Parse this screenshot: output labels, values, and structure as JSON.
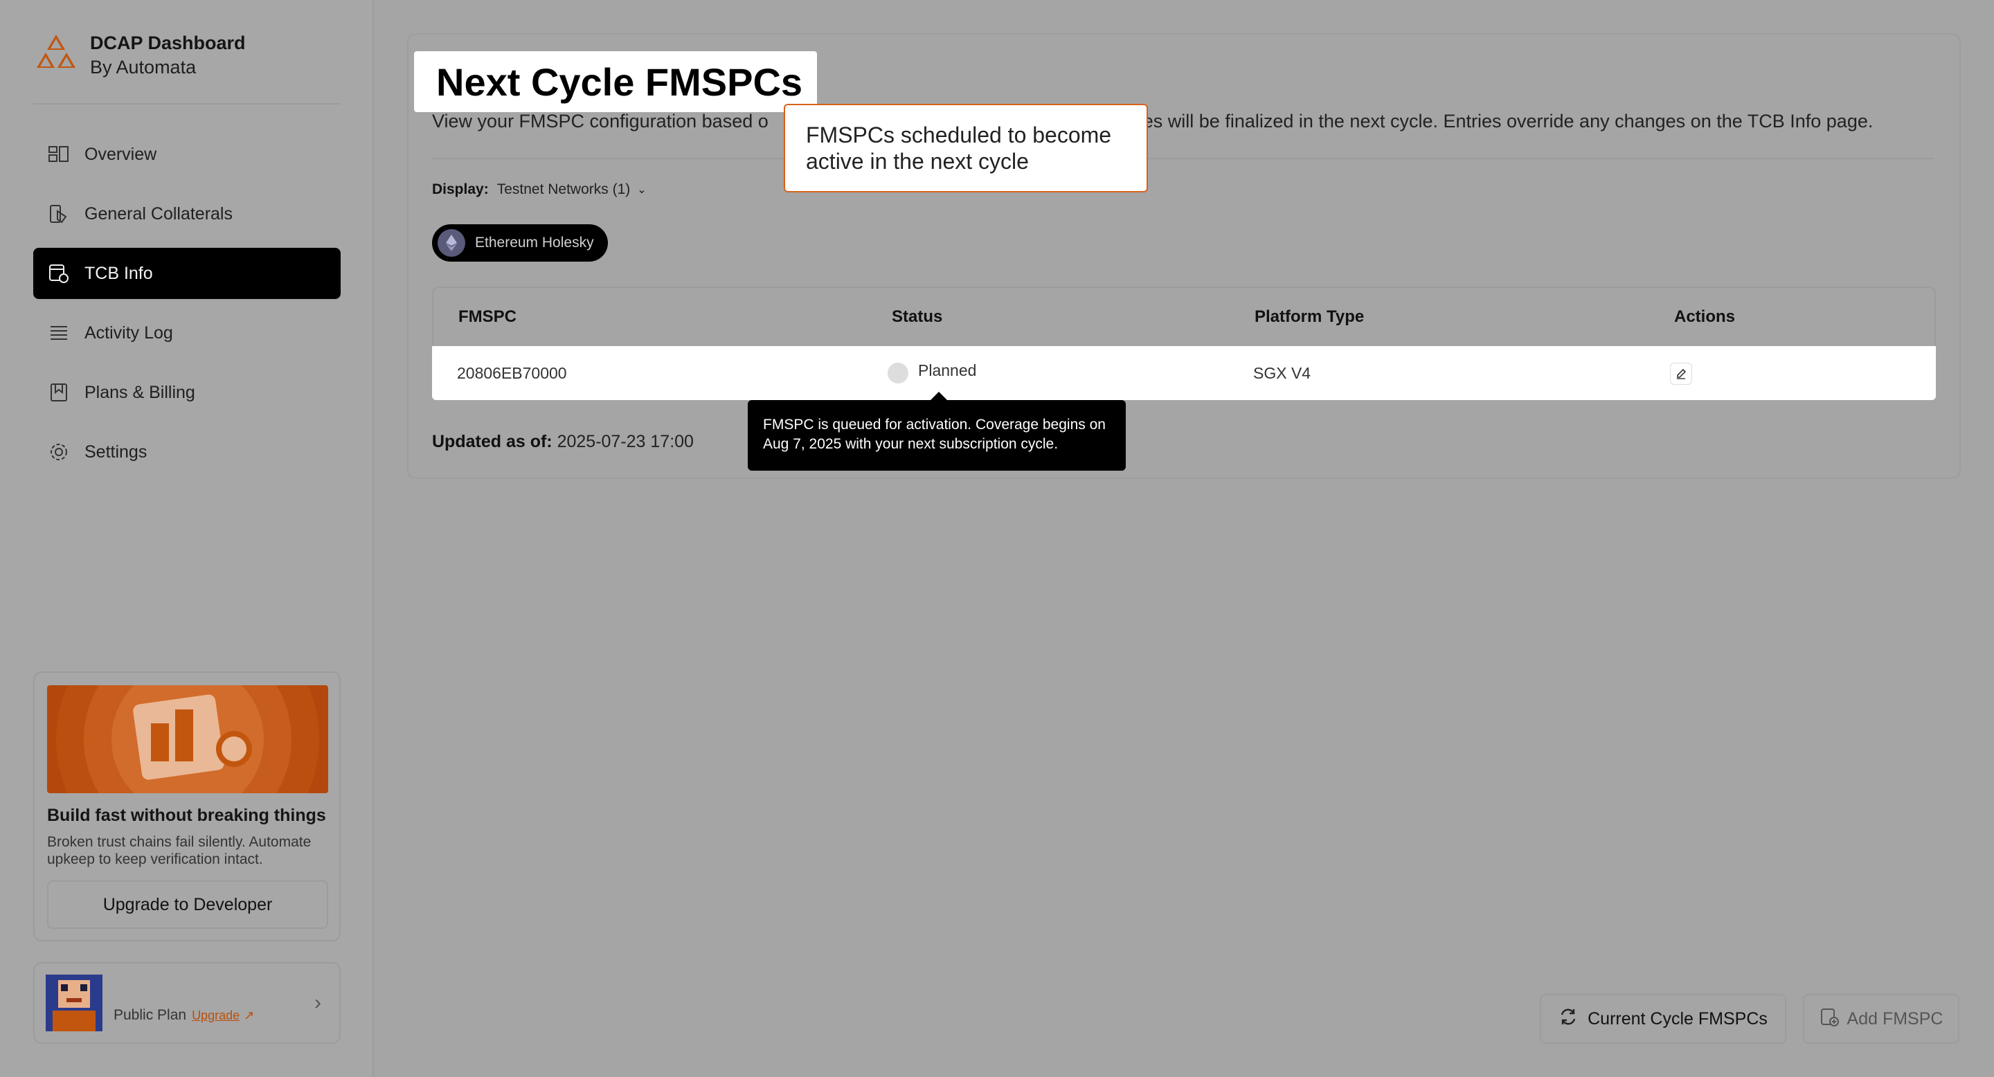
{
  "sidebar": {
    "brand": {
      "title": "DCAP Dashboard",
      "subtitle": "By Automata"
    },
    "items": [
      {
        "label": "Overview",
        "icon": "overview-icon"
      },
      {
        "label": "General Collaterals",
        "icon": "collaterals-icon"
      },
      {
        "label": "TCB Info",
        "icon": "tcb-info-icon",
        "active": true
      },
      {
        "label": "Activity Log",
        "icon": "activity-log-icon"
      },
      {
        "label": "Plans & Billing",
        "icon": "billing-icon"
      },
      {
        "label": "Settings",
        "icon": "gear-icon"
      }
    ],
    "promo": {
      "title": "Build fast without breaking things",
      "description": "Broken trust chains fail silently. Automate upkeep to keep verification intact.",
      "button": "Upgrade to Developer"
    },
    "plan": {
      "label": "Public Plan",
      "upgrade": "Upgrade"
    }
  },
  "main": {
    "title": "Next Cycle FMSPCs",
    "subtitle": "View your FMSPC configuration based on the … changes will be finalized in the next cycle. Entries override any changes on the TCB Info page.",
    "subtitle_left": "View your FMSPC configuration based o",
    "subtitle_right": "ges will be finalized in the next cycle. Entries override any changes on the TCB Info page.",
    "display_label": "Display:",
    "display_value": "Testnet Networks (1)",
    "network_chip": "Ethereum Holesky",
    "table": {
      "headers": [
        "FMSPC",
        "Status",
        "Platform Type",
        "Actions"
      ],
      "rows": [
        {
          "fmspc": "20806EB70000",
          "status": "Planned",
          "platform": "SGX V4"
        }
      ]
    },
    "updated_label": "Updated as of:",
    "updated_value": "2025-07-23 17:00",
    "callout": "FMSPCs scheduled to become active in the next cycle",
    "tooltip": "FMSPC is queued for activation. Coverage begins on Aug 7, 2025 with your next subscription cycle.",
    "buttons": {
      "current_cycle": "Current Cycle FMSPCs",
      "add": "Add FMSPC"
    }
  },
  "colors": {
    "accent": "#d9611a",
    "active_nav": "#000000"
  }
}
